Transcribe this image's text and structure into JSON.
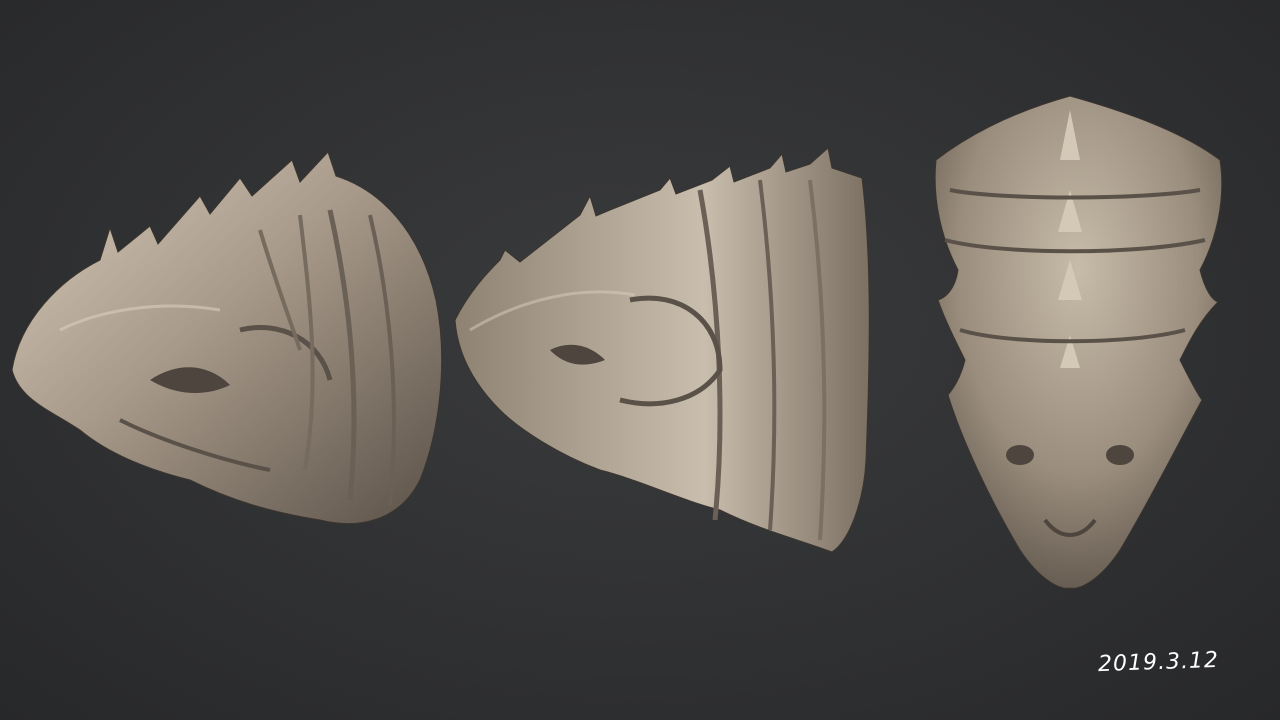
{
  "views": [
    {
      "id": "left-side-view"
    },
    {
      "id": "right-side-view"
    },
    {
      "id": "top-view"
    }
  ],
  "signature": {
    "text": "2019.3.12",
    "color": "#ffffff"
  },
  "colors": {
    "background": "#2e2f31",
    "clay": "#a89a8a",
    "clay_highlight": "#d8ccbc",
    "clay_shadow": "#4e463e"
  }
}
